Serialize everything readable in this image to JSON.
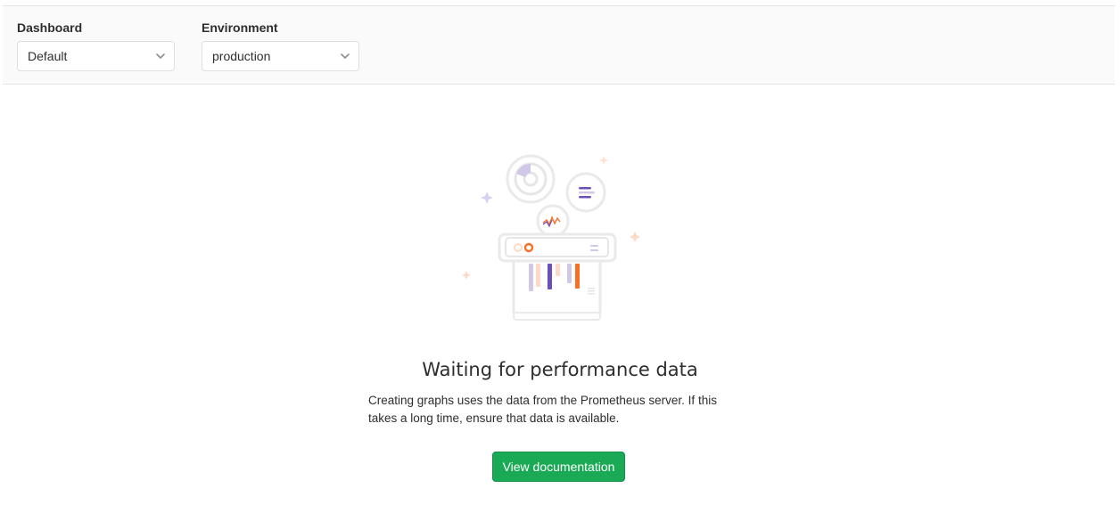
{
  "filters": {
    "dashboard": {
      "label": "Dashboard",
      "value": "Default"
    },
    "environment": {
      "label": "Environment",
      "value": "production"
    }
  },
  "empty_state": {
    "title": "Waiting for performance data",
    "description": "Creating graphs uses the data from the Prometheus server. If this takes a long time, ensure that data is available.",
    "button_label": "View documentation"
  },
  "colors": {
    "primary_button": "#1aaa55",
    "accent_orange": "#fc6d26",
    "accent_purple": "#6b4fbb",
    "light_purple": "#d1c8e8",
    "light_orange": "#fdd9c7"
  },
  "icons": {
    "select_arrow": "chevron-down-icon",
    "illustration": "monitoring-empty-state-illustration"
  }
}
